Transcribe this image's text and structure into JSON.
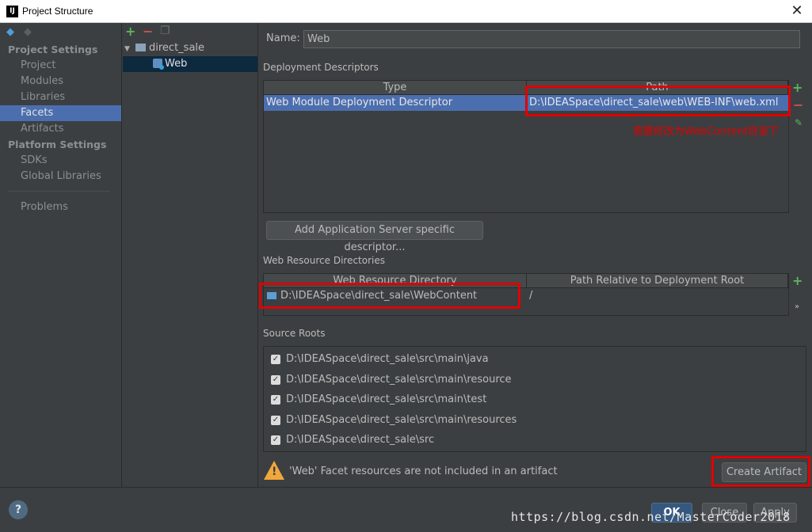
{
  "window": {
    "title": "Project Structure",
    "app_icon_text": "IJ",
    "close_symbol": "✕"
  },
  "nav": {
    "sections": [
      {
        "title": "Project Settings",
        "items": [
          "Project",
          "Modules",
          "Libraries",
          "Facets",
          "Artifacts"
        ]
      },
      {
        "title": "Platform Settings",
        "items": [
          "SDKs",
          "Global Libraries"
        ]
      }
    ],
    "problems": "Problems",
    "selected": "Facets"
  },
  "tree": {
    "root": "direct_sale",
    "child": "Web"
  },
  "facet": {
    "name_label": "Name:",
    "name_value": "Web",
    "deployment": {
      "title": "Deployment Descriptors",
      "col_type": "Type",
      "col_path": "Path",
      "row_type": "Web Module Deployment Descriptor",
      "row_path": "D:\\IDEASpace\\direct_sale\\web\\WEB-INF\\web.xml",
      "annotation": "需要修改为WebContent目录下",
      "add_button": "Add Application Server specific descriptor..."
    },
    "web_resources": {
      "title": "Web Resource Directories",
      "col_dir": "Web Resource Directory",
      "col_rel": "Path Relative to Deployment Root",
      "row_dir": "D:\\IDEASpace\\direct_sale\\WebContent",
      "row_rel": "/"
    },
    "source_roots": {
      "title": "Source Roots",
      "items": [
        "D:\\IDEASpace\\direct_sale\\src\\main\\java",
        "D:\\IDEASpace\\direct_sale\\src\\main\\resource",
        "D:\\IDEASpace\\direct_sale\\src\\main\\test",
        "D:\\IDEASpace\\direct_sale\\src\\main\\resources",
        "D:\\IDEASpace\\direct_sale\\src"
      ]
    },
    "warning": "'Web' Facet resources are not included in an artifact",
    "create_artifact": "Create Artifact"
  },
  "footer": {
    "help": "?",
    "ok": "OK",
    "cancel": "Close",
    "apply": "Apply",
    "watermark": "https://blog.csdn.net/MasterCoder2018"
  },
  "colors": {
    "bg": "#3c3f41",
    "selection": "#4b6eaf",
    "highlight_box": "#e00000",
    "add_green": "#5ab55a",
    "remove_red": "#c75450"
  }
}
